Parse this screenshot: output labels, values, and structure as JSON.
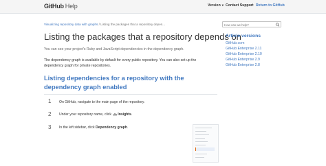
{
  "header": {
    "logo_main": "GitHub",
    "logo_help": "Help",
    "version_label": "Version",
    "support_label": "Contact Support",
    "return_label": "Return to GitHub"
  },
  "breadcrumb": {
    "parent": "Visualizing repository data with graphs",
    "separator": " / ",
    "current": "Listing the packages that a repository depen..."
  },
  "search": {
    "placeholder": "How can we help?"
  },
  "article": {
    "title": "Listing the packages that a repository depends on",
    "intro": "You can see your project's Ruby and JavaScript dependencies in the dependency graph.",
    "paragraph": "The dependency graph is available by default for every public repository. You can also set up the dependency graph for private repositories.",
    "section_heading": "Listing dependencies for a repository with the dependency graph enabled",
    "steps": [
      {
        "num": "1",
        "text": "On GitHub, navigate to the main page of the repository."
      },
      {
        "num": "2",
        "pre": "Under your repository name, click ",
        "bold": "Insights",
        "post": "."
      },
      {
        "num": "3",
        "pre": "In the left sidebar, click ",
        "bold": "Dependency graph",
        "post": "."
      }
    ]
  },
  "sidebar": {
    "title": "Article versions",
    "versions": [
      "GitHub.com",
      "GitHub Enterprise 2.11",
      "GitHub Enterprise 2.10",
      "GitHub Enterprise 2.9",
      "GitHub Enterprise 2.8"
    ]
  },
  "colors": {
    "link": "#4078c0",
    "header_bg": "#f5f5f5"
  },
  "icons": {
    "search": "magnifier-icon",
    "insights": "graph-icon",
    "version_caret": "caret-down-icon"
  }
}
